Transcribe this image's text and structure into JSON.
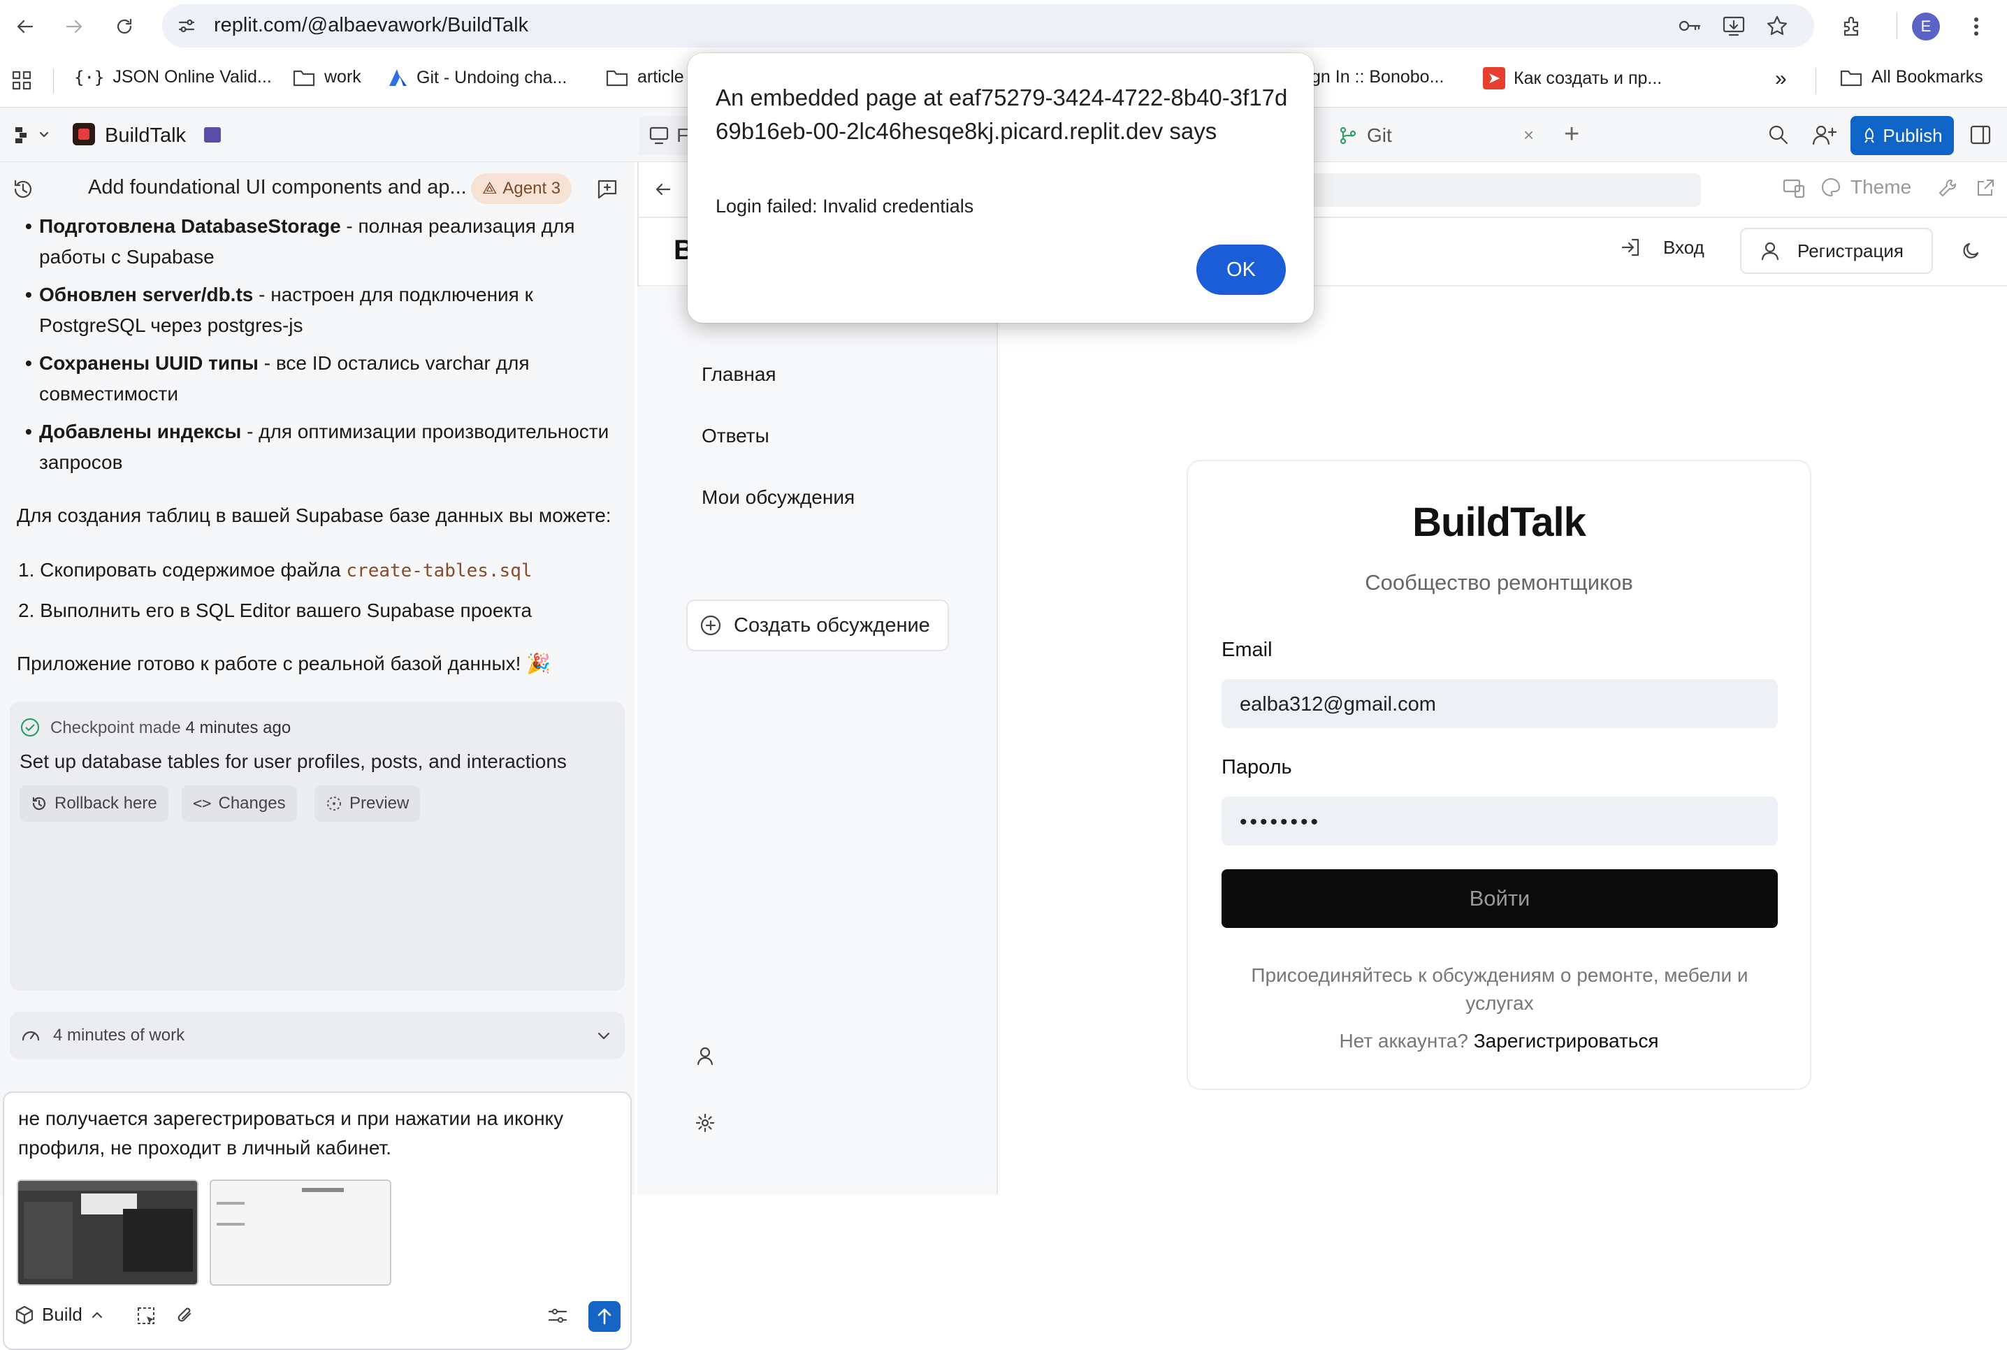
{
  "browser": {
    "url": "replit.com/@albaevawork/BuildTalk",
    "profile_initial": "E",
    "bookmarks": [
      {
        "label": "JSON Online Valid...",
        "icon": "json-icon"
      },
      {
        "label": "work",
        "icon": "folder-icon"
      },
      {
        "label": "Git - Undoing cha...",
        "icon": "atlassian-icon"
      },
      {
        "label": "article",
        "icon": "folder-icon"
      },
      {
        "label": "gn In :: Bonobo...",
        "icon": ""
      },
      {
        "label": "Как создать и пр...",
        "icon": "red-logo-icon"
      }
    ],
    "all_bookmarks": "All Bookmarks",
    "more": "»"
  },
  "replit": {
    "project_name": "BuildTalk",
    "git_tab": "Git",
    "partial_tab": "F",
    "publish": "Publish"
  },
  "chat": {
    "header_title": "Add foundational UI components and ap...",
    "agent_badge": "Agent 3",
    "bullets": [
      {
        "bold": "Подготовлена DatabaseStorage",
        "rest": " - полная реализация для работы с Supabase"
      },
      {
        "bold": "Обновлен server/db.ts",
        "rest": " - настроен для подключения к PostgreSQL через postgres-js"
      },
      {
        "bold": "Сохранены UUID типы",
        "rest": " - все ID остались varchar для совместимости"
      },
      {
        "bold": "Добавлены индексы",
        "rest": " - для оптимизации производительности запросов"
      }
    ],
    "intro": "Для создания таблиц в вашей Supabase базе данных вы можете:",
    "step1_prefix": "1. Скопировать содержимое файла ",
    "step1_code": "create-tables.sql",
    "step2": "2. Выполнить его в SQL Editor вашего Supabase проекта",
    "ready": "Приложение готово к работе с реальной базой данных! 🎉",
    "checkpoint_label": "Checkpoint made",
    "checkpoint_time": "4 minutes ago",
    "checkpoint_desc": "Set up database tables for user profiles, posts, and interactions",
    "rollback": "Rollback here",
    "changes": "Changes",
    "preview": "Preview",
    "work_time": "4 minutes of work",
    "input_text": "не получается зарегестрироваться и при нажатии на иконку профиля, не проходит в личный кабинет.",
    "build_label": "Build"
  },
  "webview": {
    "theme_label": "Theme",
    "login_link": "Вход",
    "register_button": "Регистрация",
    "site_letter": "B",
    "nav": [
      "Главная",
      "Ответы",
      "Мои обсуждения"
    ],
    "create_discussion": "Создать обсуждение",
    "card": {
      "logo": "BuildTalk",
      "subtitle": "Сообщество ремонтщиков",
      "email_label": "Email",
      "email_value": "ealba312@gmail.com",
      "password_label": "Пароль",
      "password_value": "••••••••",
      "submit": "Войти",
      "footer": "Присоединяйтесь к обсуждениям о ремонте, мебели и услугах",
      "no_account": "Нет аккаунта?",
      "register_link": "Зарегистрироваться"
    }
  },
  "dialog": {
    "title": "An embedded page at eaf75279-3424-4722-8b40-3f17d69b16eb-00-2lc46hesqe8kj.picard.replit.dev says",
    "message": "Login failed: Invalid credentials",
    "ok": "OK"
  }
}
